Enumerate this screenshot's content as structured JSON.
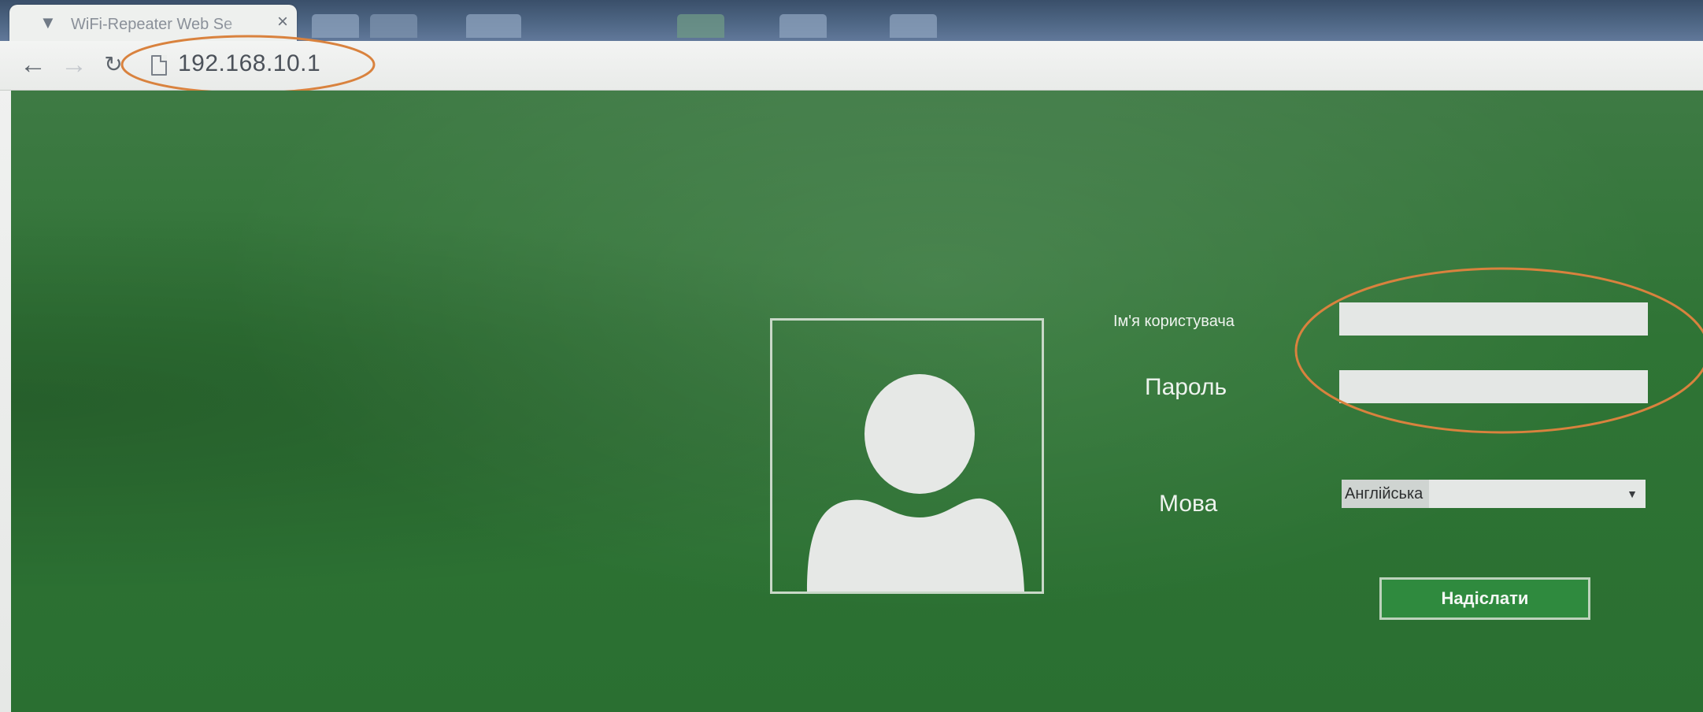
{
  "browser": {
    "tab_title": "WiFi-Repeater Web Se",
    "tab_favicon": "wifi-icon",
    "close_glyph": "×",
    "back_glyph": "←",
    "forward_glyph": "→",
    "reload_glyph": "↻",
    "url": "192.168.10.1"
  },
  "login": {
    "username_label": "Ім'я користувача",
    "password_label": "Пароль",
    "language_label": "Мова",
    "username_value": "",
    "password_value": "",
    "language_selected": "Англійська",
    "dropdown_glyph": "▼",
    "submit_label": "Надіслати"
  },
  "colors": {
    "page_green": "#2f7435",
    "button_green": "#2f8a3e",
    "highlight_orange": "#d9823e"
  }
}
